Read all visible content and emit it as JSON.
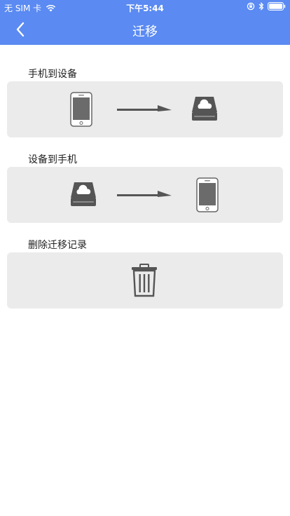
{
  "status_bar": {
    "carrier": "无 SIM 卡",
    "time": "下午5:44"
  },
  "nav": {
    "title": "迁移",
    "back_icon": "chevron-left-icon"
  },
  "sections": [
    {
      "label": "手机到设备",
      "from_icon": "phone-icon",
      "to_icon": "cloud-drive-icon"
    },
    {
      "label": "设备到手机",
      "from_icon": "cloud-drive-icon",
      "to_icon": "phone-icon"
    },
    {
      "label": "删除迁移记录",
      "icon": "trash-icon"
    }
  ],
  "colors": {
    "header": "#5a8af2",
    "card": "#ebebeb",
    "icon": "#555555"
  }
}
